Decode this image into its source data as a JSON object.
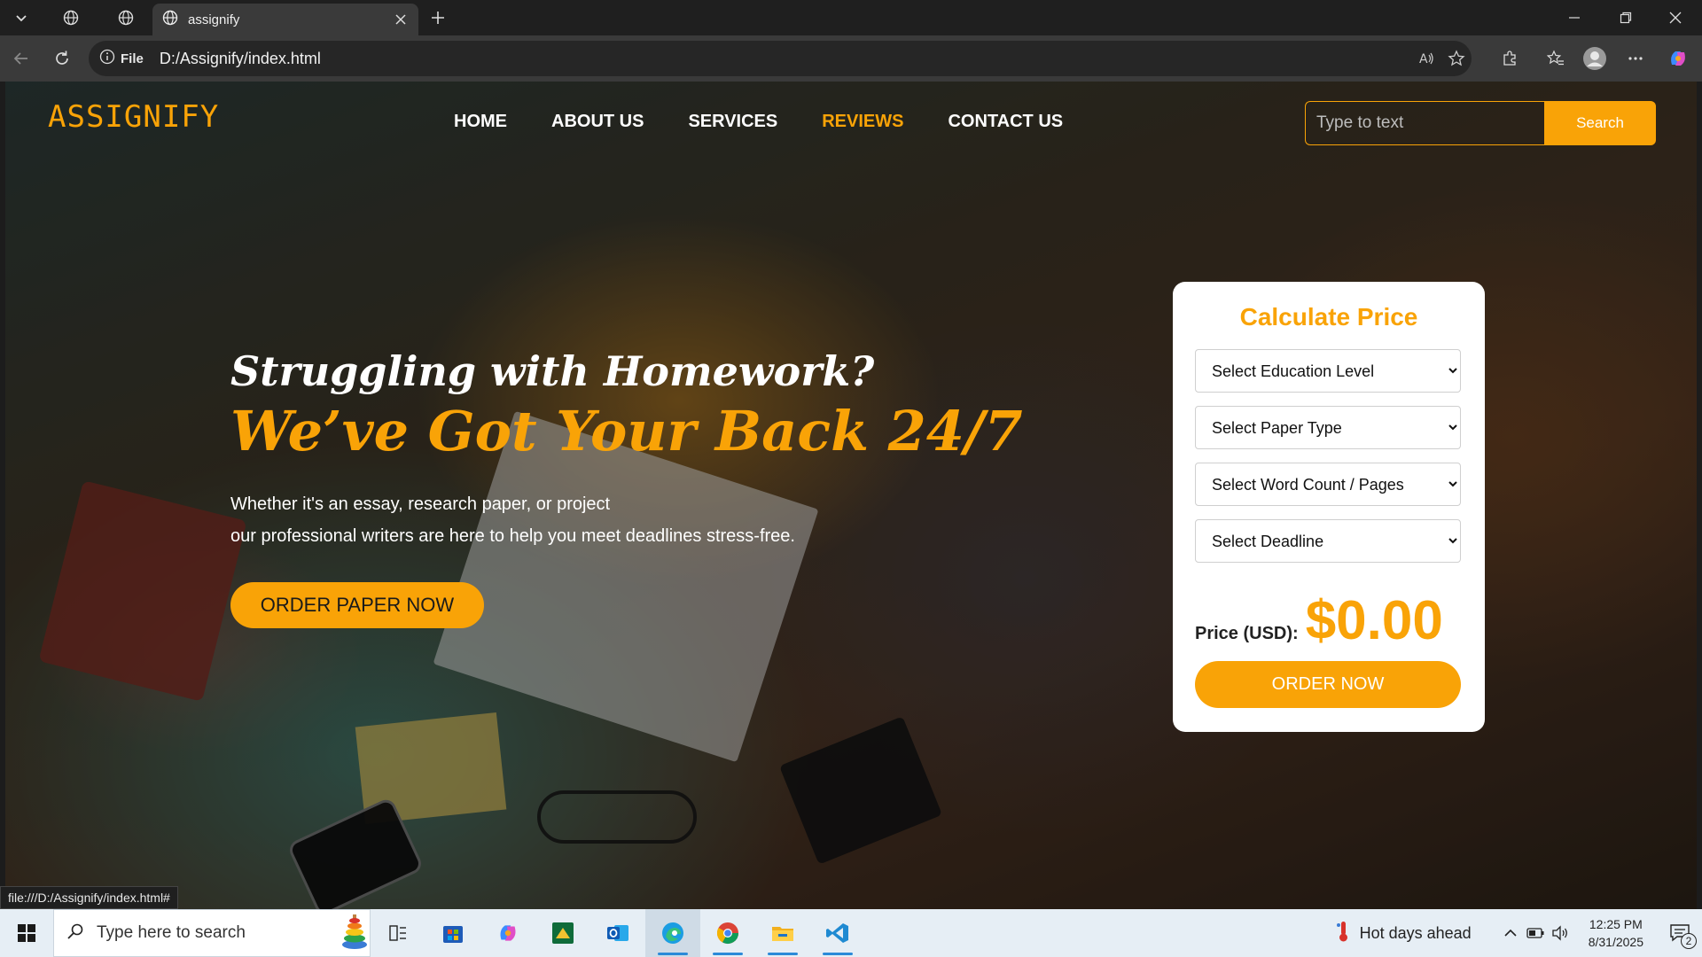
{
  "browser": {
    "tab_title": "assignify",
    "url_scheme_label": "File",
    "url": "D:/Assignify/index.html",
    "status_url": "file:///D:/Assignify/index.html#"
  },
  "site": {
    "logo": "ASSIGNIFY",
    "nav": [
      {
        "label": "HOME"
      },
      {
        "label": "ABOUT US"
      },
      {
        "label": "SERVICES"
      },
      {
        "label": "REVIEWS"
      },
      {
        "label": "CONTACT US"
      }
    ],
    "active_nav": "REVIEWS",
    "search_placeholder": "Type to text",
    "search_button": "Search"
  },
  "hero": {
    "line1": "Struggling with Homework?",
    "line2": "We’ve Got Your Back 24/7",
    "desc_line1": "Whether it's an essay, research paper, or project",
    "desc_line2": "our professional writers are here to help you meet deadlines stress-free.",
    "cta": "ORDER PAPER NOW"
  },
  "calculator": {
    "title": "Calculate Price",
    "selects": [
      "Select Education Level",
      "Select Paper Type",
      "Select Word Count / Pages",
      "Select Deadline"
    ],
    "price_label": "Price (USD):",
    "price_value": "$0.00",
    "order_button": "ORDER NOW"
  },
  "taskbar": {
    "search_placeholder": "Type here to search",
    "weather": "Hot days ahead",
    "time": "12:25 PM",
    "date": "8/31/2025",
    "notification_count": "2"
  },
  "colors": {
    "accent": "#f9a307",
    "chrome_bg": "#1f1f1f",
    "taskbar_bg": "#e6eef5"
  }
}
